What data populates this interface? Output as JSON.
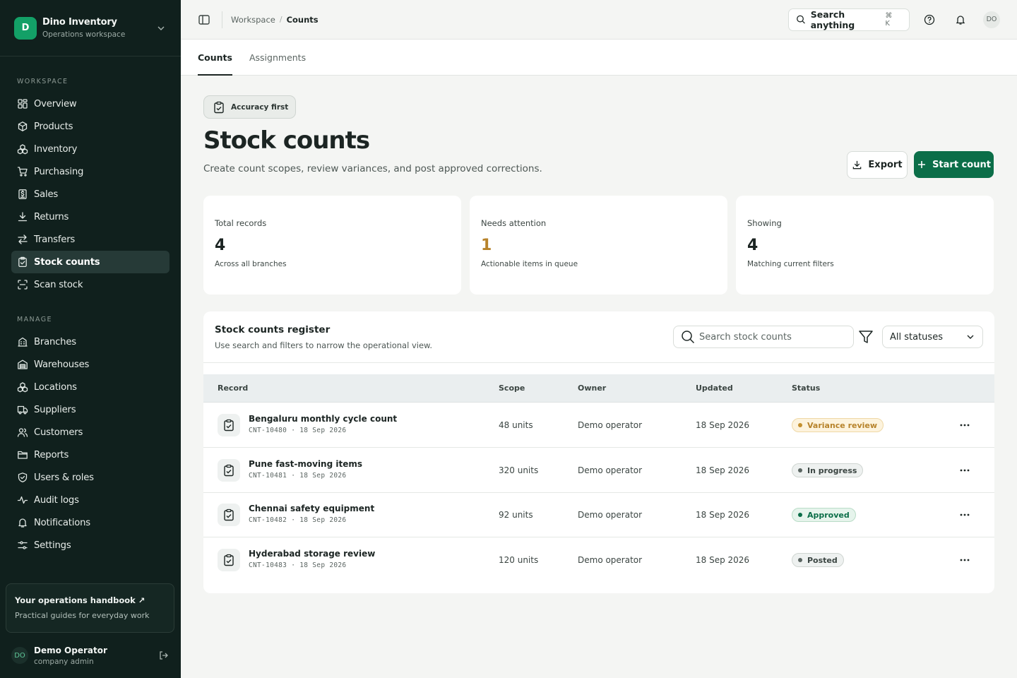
{
  "brand": {
    "initial": "D",
    "name": "Dino Inventory",
    "subtitle": "Operations workspace"
  },
  "nav": {
    "workspace_label": "WORKSPACE",
    "workspace_items": [
      {
        "label": "Overview",
        "icon": "grid-icon"
      },
      {
        "label": "Products",
        "icon": "box-icon"
      },
      {
        "label": "Inventory",
        "icon": "boxes-icon"
      },
      {
        "label": "Purchasing",
        "icon": "cart-icon"
      },
      {
        "label": "Sales",
        "icon": "receipt-icon"
      },
      {
        "label": "Returns",
        "icon": "download-icon"
      },
      {
        "label": "Transfers",
        "icon": "arrows-icon"
      },
      {
        "label": "Stock counts",
        "icon": "clipboard-check-icon",
        "active": true
      },
      {
        "label": "Scan stock",
        "icon": "scan-icon"
      }
    ],
    "manage_label": "MANAGE",
    "manage_items": [
      {
        "label": "Branches",
        "icon": "building-icon"
      },
      {
        "label": "Warehouses",
        "icon": "warehouse-icon"
      },
      {
        "label": "Locations",
        "icon": "boxes-icon"
      },
      {
        "label": "Suppliers",
        "icon": "truck-icon"
      },
      {
        "label": "Customers",
        "icon": "users-icon"
      },
      {
        "label": "Reports",
        "icon": "folder-icon"
      },
      {
        "label": "Users & roles",
        "icon": "shield-icon"
      },
      {
        "label": "Audit logs",
        "icon": "activity-icon"
      },
      {
        "label": "Notifications",
        "icon": "bell-icon"
      },
      {
        "label": "Settings",
        "icon": "sliders-icon"
      }
    ]
  },
  "handbook": {
    "title": "Your operations handbook ↗",
    "subtitle": "Practical guides for everyday work"
  },
  "user": {
    "initials": "DO",
    "name": "Demo Operator",
    "role": "company admin"
  },
  "breadcrumb": {
    "parent": "Workspace",
    "separator": "/",
    "current": "Counts"
  },
  "topbar": {
    "search_label": "Search anything",
    "search_shortcut": "⌘ K",
    "avatar": "DO"
  },
  "tabs": [
    {
      "label": "Counts",
      "active": true
    },
    {
      "label": "Assignments",
      "active": false
    }
  ],
  "page": {
    "pill": "Accuracy first",
    "title": "Stock counts",
    "subtitle": "Create count scopes, review variances, and post approved corrections.",
    "export_label": "Export",
    "start_label": "Start count"
  },
  "stats": [
    {
      "label": "Total records",
      "value": "4",
      "note": "Across all branches"
    },
    {
      "label": "Needs attention",
      "value": "1",
      "note": "Actionable items in queue"
    },
    {
      "label": "Showing",
      "value": "4",
      "note": "Matching current filters"
    }
  ],
  "register": {
    "title": "Stock counts register",
    "subtitle": "Use search and filters to narrow the operational view.",
    "search_placeholder": "Search stock counts",
    "status_filter": "All statuses",
    "columns": {
      "record": "Record",
      "scope": "Scope",
      "owner": "Owner",
      "updated": "Updated",
      "status": "Status"
    },
    "rows": [
      {
        "title": "Bengaluru monthly cycle count",
        "meta": "CNT-10480 · 18 Sep 2026",
        "scope": "48 units",
        "owner": "Demo operator",
        "updated": "18 Sep 2026",
        "status": "Variance review"
      },
      {
        "title": "Pune fast-moving items",
        "meta": "CNT-10481 · 18 Sep 2026",
        "scope": "320 units",
        "owner": "Demo operator",
        "updated": "18 Sep 2026",
        "status": "In progress"
      },
      {
        "title": "Chennai safety equipment",
        "meta": "CNT-10482 · 18 Sep 2026",
        "scope": "92 units",
        "owner": "Demo operator",
        "updated": "18 Sep 2026",
        "status": "Approved"
      },
      {
        "title": "Hyderabad storage review",
        "meta": "CNT-10483 · 18 Sep 2026",
        "scope": "120 units",
        "owner": "Demo operator",
        "updated": "18 Sep 2026",
        "status": "Posted"
      }
    ]
  },
  "colors": {
    "sidebar_bg": "#10201d",
    "accent": "#0b6e48",
    "warn": "#b7832b",
    "badge_variance": "#b7832b",
    "badge_progress": "#5b6562",
    "badge_approved": "#0b6e48",
    "badge_posted": "#5b6562"
  }
}
